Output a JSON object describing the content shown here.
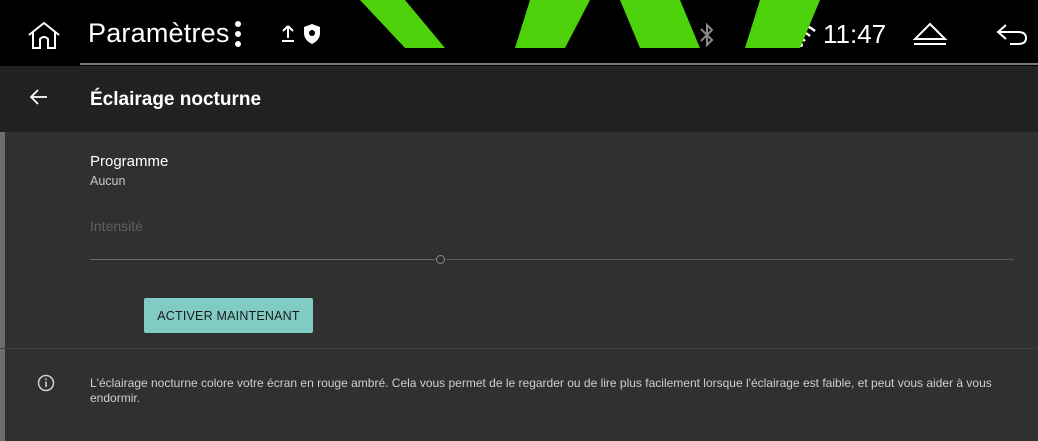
{
  "statusbar": {
    "app_title": "Paramètres",
    "time": "11:47",
    "icons": [
      "home-icon",
      "more-vert-icon",
      "upload-icon",
      "shield-icon",
      "bluetooth-icon",
      "location-pin-icon",
      "wifi-icon",
      "eject-icon",
      "back-icon"
    ]
  },
  "appbar": {
    "title": "Éclairage nocturne",
    "back_icon": "arrow-left-icon"
  },
  "settings": {
    "schedule": {
      "title": "Programme",
      "value": "Aucun"
    },
    "intensity": {
      "label": "Intensité",
      "level_percent": 38
    },
    "activate_button": "ACTIVER MAINTENANT"
  },
  "footer": {
    "icon": "info-icon",
    "text": "L'éclairage nocturne colore votre écran en rouge ambré. Cela vous permet de le regarder ou de lire plus facilement lorsque l'éclairage est faible, et peut vous aider à vous endormir."
  },
  "colors": {
    "background": "#303030",
    "statusbar": "#000000",
    "appbar": "#212121",
    "accent_button": "#80cbc4",
    "overlay_green": "#4cd10a"
  }
}
